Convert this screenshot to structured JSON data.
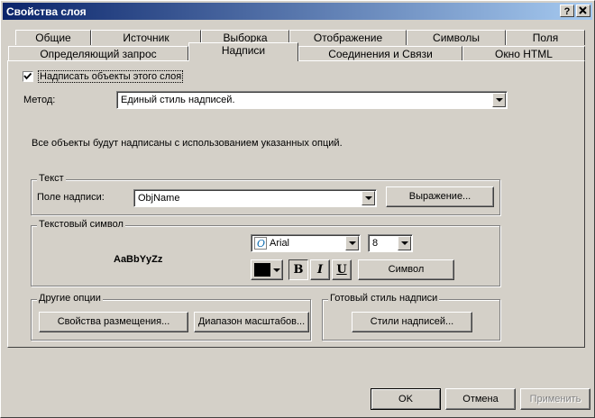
{
  "window": {
    "title": "Свойства слоя",
    "help_btn": "?",
    "close_btn": "X"
  },
  "tabs_row1": [
    "Общие",
    "Источник",
    "Выборка",
    "Отображение",
    "Символы",
    "Поля"
  ],
  "tabs_row2": [
    "Определяющий запрос",
    "Надписи",
    "Соединения и Связи",
    "Окно HTML"
  ],
  "label_check": {
    "label": "Надписать объекты этого слоя",
    "checked": true
  },
  "method": {
    "label": "Метод:",
    "value": "Единый стиль надписей."
  },
  "info_text": "Все объекты будут надписаны с использованием указанных опций.",
  "text_group": {
    "title": "Текст",
    "field_label": "Поле надписи:",
    "field_value": "ObjName",
    "expression_btn": "Выражение..."
  },
  "symbol_group": {
    "title": "Текстовый символ",
    "preview": "AaBbYyZz",
    "font": "Arial",
    "size": "8",
    "color": "#000000",
    "bold": "B",
    "italic": "I",
    "underline": "U",
    "symbol_btn": "Символ"
  },
  "other_group": {
    "title": "Другие опции",
    "placement_btn": "Свойства размещения...",
    "scale_btn": "Диапазон масштабов..."
  },
  "style_group": {
    "title": "Готовый стиль надписи",
    "styles_btn": "Стили надписей..."
  },
  "footer": {
    "ok": "OK",
    "cancel": "Отмена",
    "apply": "Применить"
  }
}
